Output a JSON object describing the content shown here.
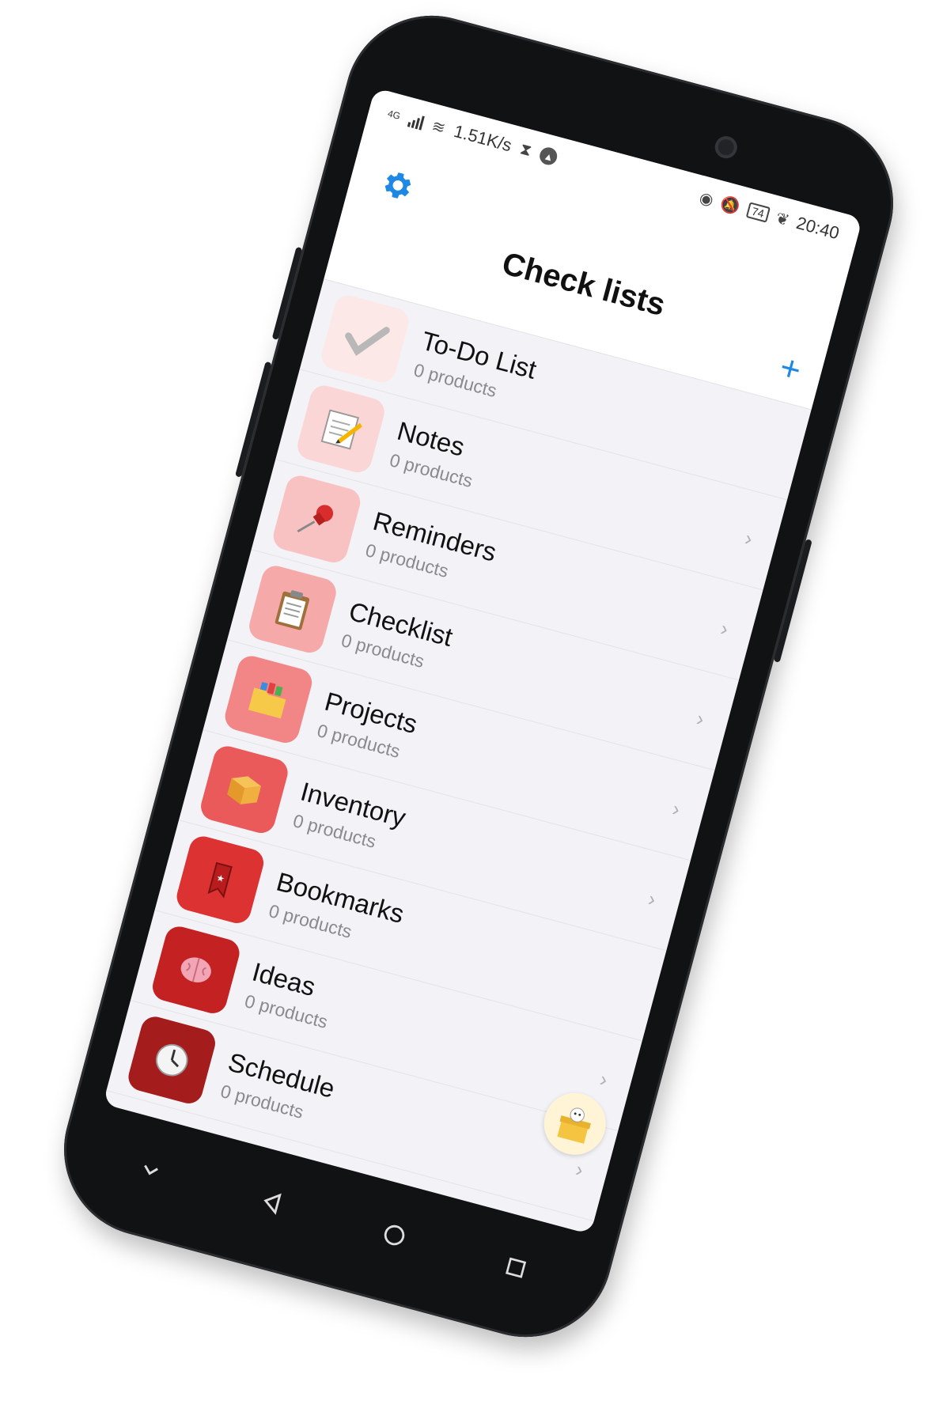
{
  "status_bar": {
    "network": "4G",
    "speed": "1.51K/s",
    "battery": "74",
    "time": "20:40"
  },
  "header": {
    "title": "Check lists",
    "settings_icon": "gear-icon",
    "add_icon": "plus-icon",
    "add_label": "+"
  },
  "lists": [
    {
      "name": "To-Do List",
      "count": "0 products",
      "icon": "checkmark-icon",
      "color": "#fde8e8"
    },
    {
      "name": "Notes",
      "count": "0 products",
      "icon": "notepad-pencil-icon",
      "color": "#fbd6d6"
    },
    {
      "name": "Reminders",
      "count": "0 products",
      "icon": "pushpin-icon",
      "color": "#f9c2c2"
    },
    {
      "name": "Checklist",
      "count": "0 products",
      "icon": "clipboard-icon",
      "color": "#f6a9a9"
    },
    {
      "name": "Projects",
      "count": "0 products",
      "icon": "folder-icon",
      "color": "#f28686"
    },
    {
      "name": "Inventory",
      "count": "0 products",
      "icon": "box-icon",
      "color": "#ea5a5a"
    },
    {
      "name": "Bookmarks",
      "count": "0 products",
      "icon": "bookmark-icon",
      "color": "#dc3232"
    },
    {
      "name": "Ideas",
      "count": "0 products",
      "icon": "brain-icon",
      "color": "#c42222"
    },
    {
      "name": "Schedule",
      "count": "0 products",
      "icon": "clock-icon",
      "color": "#a51c1c"
    }
  ],
  "chevron": "›",
  "nav_bar": {
    "keys": [
      "chevron-down-icon",
      "back-icon",
      "home-icon",
      "recents-icon"
    ]
  },
  "colors": {
    "accent": "#1e88e5",
    "background": "#f2f2f7"
  }
}
